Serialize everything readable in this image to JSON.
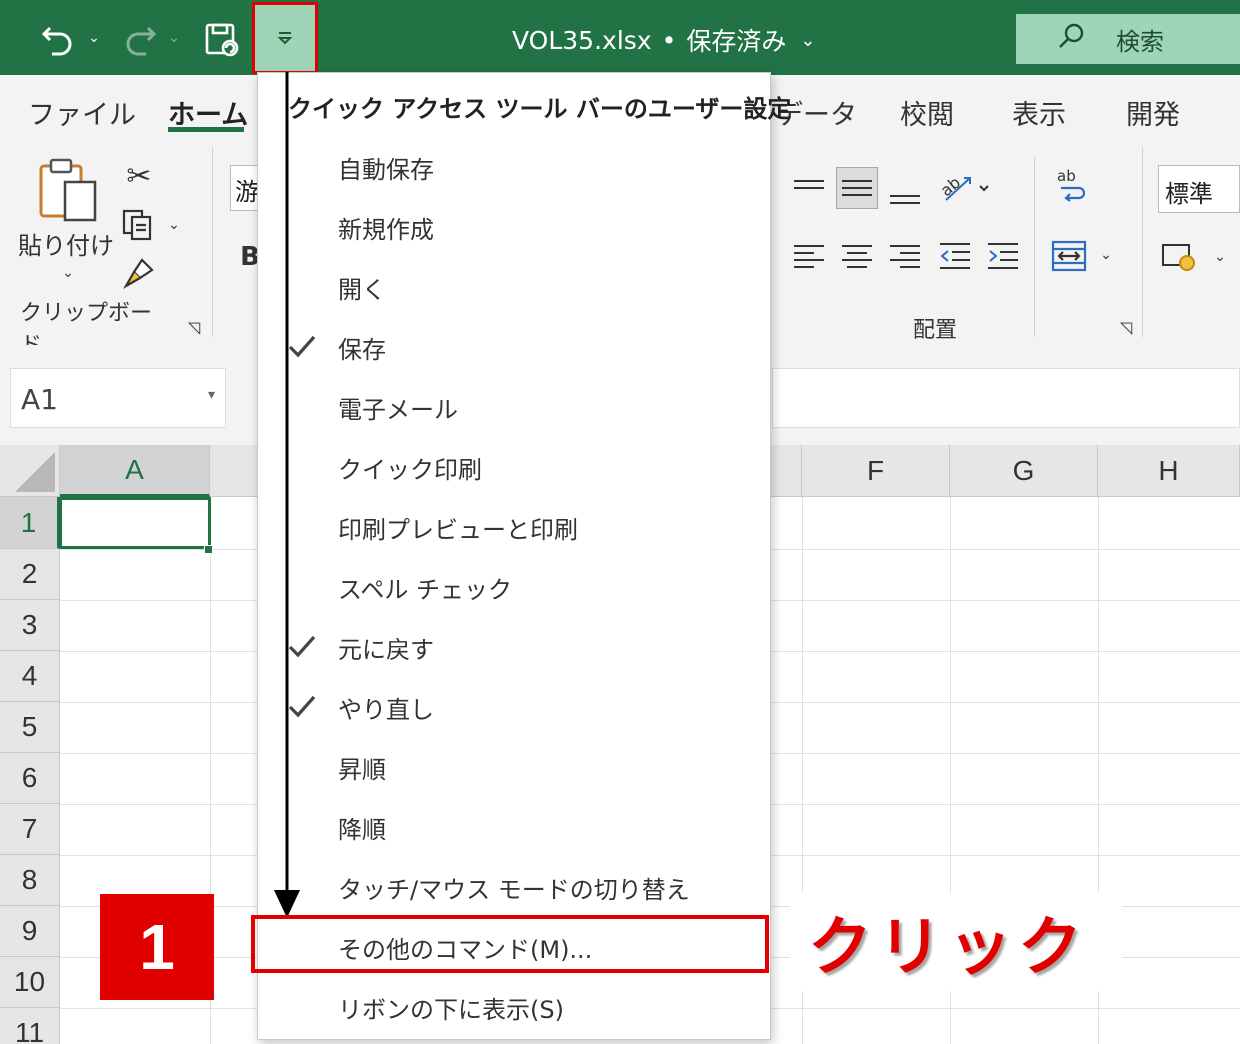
{
  "titlebar": {
    "doc_title": "VOL35.xlsx",
    "separator": "•",
    "save_status": "保存済み",
    "search_label": "検索"
  },
  "ribbon": {
    "tabs": [
      "ファイル",
      "ホーム",
      "データ",
      "校閲",
      "表示",
      "開発"
    ],
    "active_tab": "ホーム",
    "clipboard": {
      "paste_label": "貼り付け",
      "group_label": "クリップボード"
    },
    "font": {
      "font_name_partial": "游",
      "bold_label": "B"
    },
    "alignment": {
      "group_label": "配置"
    },
    "number": {
      "format_value": "標準"
    }
  },
  "formula_bar": {
    "name_box": "A1"
  },
  "grid": {
    "columns": [
      "A",
      "F",
      "G",
      "H"
    ],
    "rows": [
      "1",
      "2",
      "3",
      "4",
      "5",
      "6",
      "7",
      "8",
      "9",
      "10",
      "11"
    ],
    "active_cell": "A1"
  },
  "menu": {
    "title": "クイック アクセス ツール バーのユーザー設定",
    "items": [
      {
        "label": "自動保存",
        "checked": false
      },
      {
        "label": "新規作成",
        "checked": false
      },
      {
        "label": "開く",
        "checked": false
      },
      {
        "label": "保存",
        "checked": true
      },
      {
        "label": "電子メール",
        "checked": false
      },
      {
        "label": "クイック印刷",
        "checked": false
      },
      {
        "label": "印刷プレビューと印刷",
        "checked": false
      },
      {
        "label": "スペル チェック",
        "checked": false
      },
      {
        "label": "元に戻す",
        "checked": true
      },
      {
        "label": "やり直し",
        "checked": true
      },
      {
        "label": "昇順",
        "checked": false
      },
      {
        "label": "降順",
        "checked": false
      },
      {
        "label": "タッチ/マウス モードの切り替え",
        "checked": false
      },
      {
        "label": "その他のコマンド(M)...",
        "checked": false
      },
      {
        "label": "リボンの下に表示(S)",
        "checked": false
      }
    ]
  },
  "annotation": {
    "step_number": "1",
    "instruction": "クリック",
    "highlight_color": "#e00000"
  },
  "colors": {
    "excel_green": "#217346",
    "accent_light_green": "#9fd5b7"
  }
}
